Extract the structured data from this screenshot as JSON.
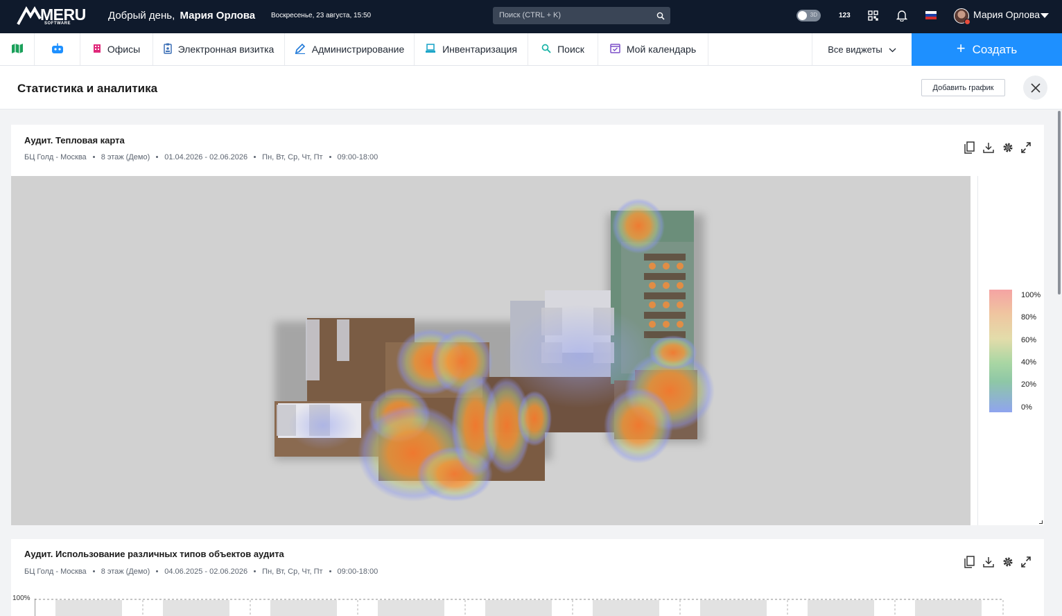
{
  "header": {
    "logo_text": "MERU",
    "logo_sub": "SOFTWARE",
    "greeting_prefix": "Добрый день,",
    "user_name": "Мария Орлова",
    "datetime": "Воскресенье, 23 августа, 15:50",
    "search_placeholder": "Поиск (CTRL + K)",
    "toggle_label": "3D",
    "counter_label": "123",
    "profile_name": "Мария Орлова"
  },
  "nav": {
    "items": [
      {
        "label": "",
        "icon": "map-icon"
      },
      {
        "label": "",
        "icon": "robot-icon"
      },
      {
        "label": "Офисы",
        "icon": "building-icon"
      },
      {
        "label": "Электронная визитка",
        "icon": "badge-icon"
      },
      {
        "label": "Администрирование",
        "icon": "pencil-icon"
      },
      {
        "label": "Инвентаризация",
        "icon": "laptop-icon"
      },
      {
        "label": "Поиск",
        "icon": "search-icon"
      },
      {
        "label": "Мой календарь",
        "icon": "calendar-icon"
      }
    ],
    "all_widgets": "Все виджеты",
    "create": "Создать"
  },
  "page": {
    "title": "Статистика и аналитика",
    "add_chart": "Добавить график"
  },
  "cards": [
    {
      "title": "Аудит. Тепловая карта",
      "meta": [
        "БЦ Голд - Москва",
        "8 этаж (Демо)",
        "01.04.2026 - 02.06.2026",
        "Пн, Вт, Ср, Чт, Пт",
        "09:00-18:00"
      ],
      "legend": [
        "100%",
        "80%",
        "60%",
        "40%",
        "20%",
        "0%"
      ]
    },
    {
      "title": "Аудит. Использование различных типов объектов аудита",
      "meta": [
        "БЦ Голд - Москва",
        "8 этаж (Демо)",
        "04.06.2025 - 02.06.2026",
        "Пн, Вт, Ср, Чт, Пт",
        "09:00-18:00"
      ],
      "y_top_label": "100%"
    }
  ],
  "colors": {
    "topbar": "#0f1a2c",
    "accent": "#1e90ff",
    "heat_hot": "#f08a3c",
    "heat_cool": "#8f9df0"
  }
}
